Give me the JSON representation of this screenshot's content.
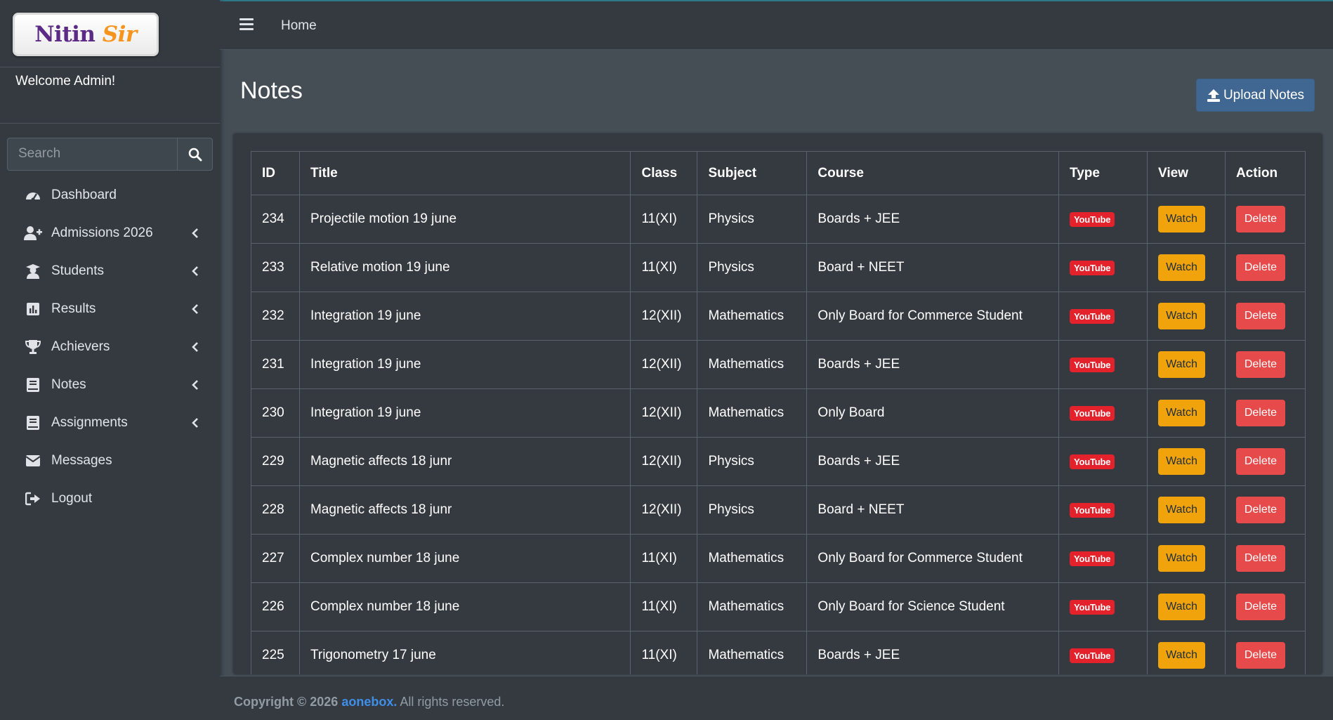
{
  "brand": {
    "logo_text": "Nitin",
    "logo_text_accent": "Sir"
  },
  "sidebar": {
    "welcome": "Welcome Admin!",
    "search_placeholder": "Search",
    "items": [
      {
        "label": "Dashboard",
        "icon": "dashboard-icon",
        "has_children": false
      },
      {
        "label": "Admissions 2026",
        "icon": "user-plus-icon",
        "has_children": true
      },
      {
        "label": "Students",
        "icon": "graduate-icon",
        "has_children": true
      },
      {
        "label": "Results",
        "icon": "chart-icon",
        "has_children": true
      },
      {
        "label": "Achievers",
        "icon": "trophy-icon",
        "has_children": true
      },
      {
        "label": "Notes",
        "icon": "book-icon",
        "has_children": true
      },
      {
        "label": "Assignments",
        "icon": "book-icon",
        "has_children": true
      },
      {
        "label": "Messages",
        "icon": "envelope-icon",
        "has_children": false
      },
      {
        "label": "Logout",
        "icon": "logout-icon",
        "has_children": false
      }
    ]
  },
  "header": {
    "home_link": "Home"
  },
  "page": {
    "title": "Notes",
    "upload_button": "Upload Notes"
  },
  "table": {
    "columns": [
      "ID",
      "Title",
      "Class",
      "Subject",
      "Course",
      "Type",
      "View",
      "Action"
    ],
    "type_badge": "YouTube",
    "watch_label": "Watch",
    "delete_label": "Delete",
    "rows": [
      {
        "id": "234",
        "title": "Projectile motion 19 june",
        "class": "11(XI)",
        "subject": "Physics",
        "course": "Boards + JEE"
      },
      {
        "id": "233",
        "title": "Relative motion 19 june",
        "class": "11(XI)",
        "subject": "Physics",
        "course": "Board + NEET"
      },
      {
        "id": "232",
        "title": "Integration 19 june",
        "class": "12(XII)",
        "subject": "Mathematics",
        "course": "Only Board for Commerce Student"
      },
      {
        "id": "231",
        "title": "Integration 19 june",
        "class": "12(XII)",
        "subject": "Mathematics",
        "course": "Boards + JEE"
      },
      {
        "id": "230",
        "title": "Integration 19 june",
        "class": "12(XII)",
        "subject": "Mathematics",
        "course": "Only Board"
      },
      {
        "id": "229",
        "title": "Magnetic affects 18 junr",
        "class": "12(XII)",
        "subject": "Physics",
        "course": "Boards + JEE"
      },
      {
        "id": "228",
        "title": "Magnetic affects 18 junr",
        "class": "12(XII)",
        "subject": "Physics",
        "course": "Board + NEET"
      },
      {
        "id": "227",
        "title": "Complex number 18 june",
        "class": "11(XI)",
        "subject": "Mathematics",
        "course": "Only Board for Commerce Student"
      },
      {
        "id": "226",
        "title": "Complex number 18 june",
        "class": "11(XI)",
        "subject": "Mathematics",
        "course": "Only Board for Science Student"
      },
      {
        "id": "225",
        "title": "Trigonometry 17 june",
        "class": "11(XI)",
        "subject": "Mathematics",
        "course": "Boards + JEE"
      }
    ]
  },
  "footer": {
    "prefix": "Copyright © 2026 ",
    "link": "aonebox.",
    "suffix": " All rights reserved."
  },
  "colors": {
    "sidebar_bg": "#343a40",
    "content_bg": "#454d55",
    "primary": "#3f6791",
    "warning": "#f0a30a",
    "danger": "#e64a4a",
    "youtube": "#e3222b",
    "link": "#3f8fe8"
  }
}
